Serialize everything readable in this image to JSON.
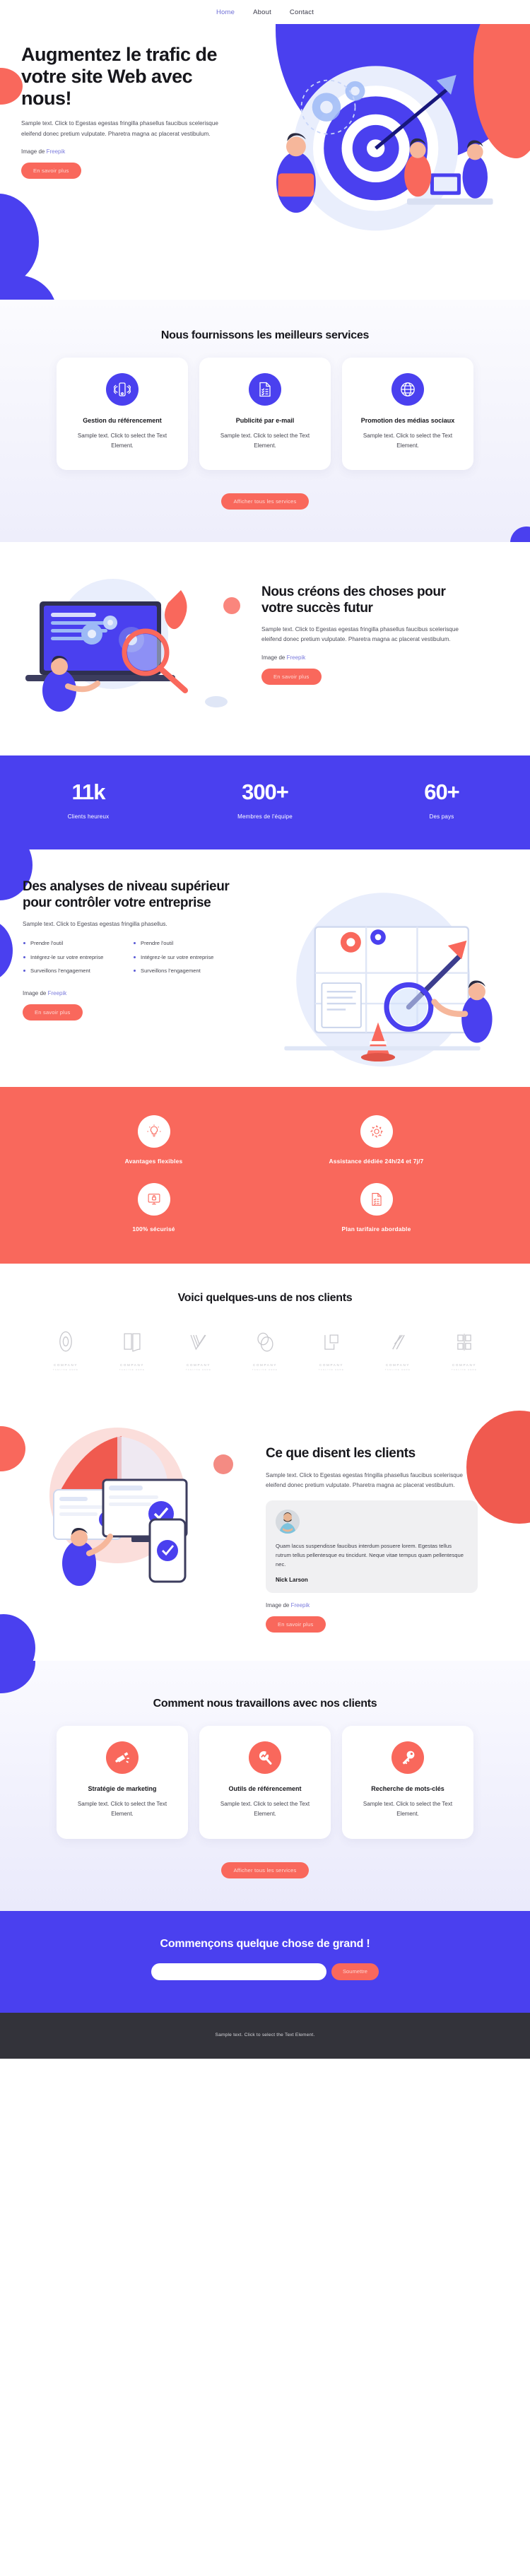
{
  "nav": {
    "items": [
      {
        "label": "Home",
        "active": true
      },
      {
        "label": "About",
        "active": false
      },
      {
        "label": "Contact",
        "active": false
      }
    ]
  },
  "hero": {
    "title": "Augmentez le trafic de votre site Web avec nous!",
    "paragraph": "Sample text. Click to Egestas egestas fringilla phasellus faucibus scelerisque eleifend donec pretium vulputate. Pharetra magna ac placerat vestibulum.",
    "credit_prefix": "Image de ",
    "credit_link": "Freepik",
    "button": "En savoir plus"
  },
  "services": {
    "title": "Nous fournissons les meilleurs services",
    "cards": [
      {
        "icon": "mobile-signal-icon",
        "title": "Gestion du référencement",
        "text": "Sample text. Click to select the Text Element."
      },
      {
        "icon": "checklist-document-icon",
        "title": "Publicité par e-mail",
        "text": "Sample text. Click to select the Text Element."
      },
      {
        "icon": "globe-icon",
        "title": "Promotion des médias sociaux",
        "text": "Sample text. Click to select the Text Element."
      }
    ],
    "button": "Afficher tous les services"
  },
  "create": {
    "title": "Nous créons des choses pour votre succès futur",
    "paragraph": "Sample text. Click to Egestas egestas fringilla phasellus faucibus scelerisque eleifend donec pretium vulputate. Pharetra magna ac placerat vestibulum.",
    "credit_prefix": "Image de ",
    "credit_link": "Freepik",
    "button": "En savoir plus"
  },
  "stats": {
    "items": [
      {
        "value": "11k",
        "label": "Clients heureux"
      },
      {
        "value": "300+",
        "label": "Membres de l'équipe"
      },
      {
        "value": "60+",
        "label": "Des pays"
      }
    ]
  },
  "analytics": {
    "title": "Des analyses de niveau supérieur pour contrôler votre entreprise",
    "paragraph": "Sample text. Click to Egestas egestas fringilla phasellus.",
    "bullets_left": [
      "Prendre l'outil",
      "Intégrez-le sur votre entreprise",
      "Surveillons l’engagement"
    ],
    "bullets_right": [
      "Prendre l'outil",
      "Intégrez-le sur votre entreprise",
      "Surveillons l’engagement"
    ],
    "credit_prefix": "Image de ",
    "credit_link": "Freepik",
    "button": "En savoir plus"
  },
  "features": {
    "items": [
      {
        "icon": "lightbulb-icon",
        "label": "Avantages flexibles"
      },
      {
        "icon": "gear-icon",
        "label": "Assistance dédiée 24h/24 et 7j/7"
      },
      {
        "icon": "secure-monitor-lock-icon",
        "label": "100% sécurisé"
      },
      {
        "icon": "pricing-document-icon",
        "label": "Plan tarifaire abordable"
      }
    ]
  },
  "clients": {
    "title": "Voici quelques-uns de nos clients",
    "logos": [
      {
        "icon": "logo-oval-mark-icon",
        "name": "COMPANY",
        "tagline": "TAGLINE HERE"
      },
      {
        "icon": "logo-book-mark-icon",
        "name": "COMPANY",
        "tagline": "TAGLINE HERE"
      },
      {
        "icon": "logo-chevron-lines-icon",
        "name": "COMPANY",
        "tagline": "TAGLINE HERE"
      },
      {
        "icon": "logo-double-circle-icon",
        "name": "COMPANY",
        "tagline": "TAGLINE HERE"
      },
      {
        "icon": "logo-squares-icon",
        "name": "COMPANY",
        "tagline": "TAGLINE HERE"
      },
      {
        "icon": "logo-slashes-icon",
        "name": "COMPANY",
        "tagline": "TAGLINE HERE"
      },
      {
        "icon": "logo-bracket-icon",
        "name": "COMPANY",
        "tagline": "TAGLINE HERE"
      }
    ]
  },
  "testimonials": {
    "title": "Ce que disent les clients",
    "paragraph": "Sample text. Click to Egestas egestas fringilla phasellus faucibus scelerisque eleifend donec pretium vulputate. Pharetra magna ac placerat vestibulum.",
    "quote": "Quam lacus suspendisse faucibus interdum posuere lorem. Egestas tellus rutrum tellus pellentesque eu tincidunt. Neque vitae tempus quam pellentesque nec.",
    "author": "Nick Larson",
    "credit_prefix": "Image de ",
    "credit_link": "Freepik",
    "button": "En savoir plus"
  },
  "work": {
    "title": "Comment nous travaillons avec nos clients",
    "cards": [
      {
        "icon": "megaphone-icon",
        "title": "Stratégie de marketing",
        "text": "Sample text. Click to select the Text Element."
      },
      {
        "icon": "magnifier-growth-icon",
        "title": "Outils de référencement",
        "text": "Sample text. Click to select the Text Element."
      },
      {
        "icon": "key-icon",
        "title": "Recherche de mots-clés",
        "text": "Sample text. Click to select the Text Element."
      }
    ],
    "button": "Afficher tous les services"
  },
  "cta": {
    "title": "Commençons quelque chose de grand !",
    "input_value": "",
    "input_placeholder": "",
    "button": "Soumettre"
  },
  "footer": {
    "text": "Sample text. Click to select the Text Element."
  },
  "colors": {
    "brand_blue": "#4a40ef",
    "accent_red": "#f9685c",
    "dark": "#33333a"
  }
}
